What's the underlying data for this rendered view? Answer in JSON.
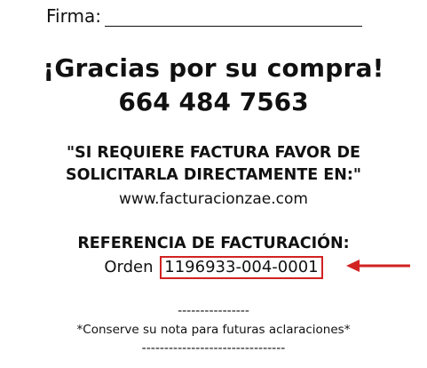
{
  "signature": {
    "label": "Firma:"
  },
  "thanks_text": "¡Gracias por su compra!",
  "phone": "664 484 7563",
  "invoice_notice": {
    "line1": "\"SI REQUIERE FACTURA FAVOR DE",
    "line2": "SOLICITARLA DIRECTAMENTE EN:\"",
    "url": "www.facturacionzae.com"
  },
  "billing_reference": {
    "title": "REFERENCIA DE FACTURACIÓN:",
    "order_label": "Orden",
    "order_number": "1196933-004-0001",
    "highlight_color": "#d22222"
  },
  "footer": {
    "separator_top": "----------------",
    "note": "*Conserve su nota para futuras aclaraciones*",
    "separator_bottom": "--------------------------------"
  }
}
